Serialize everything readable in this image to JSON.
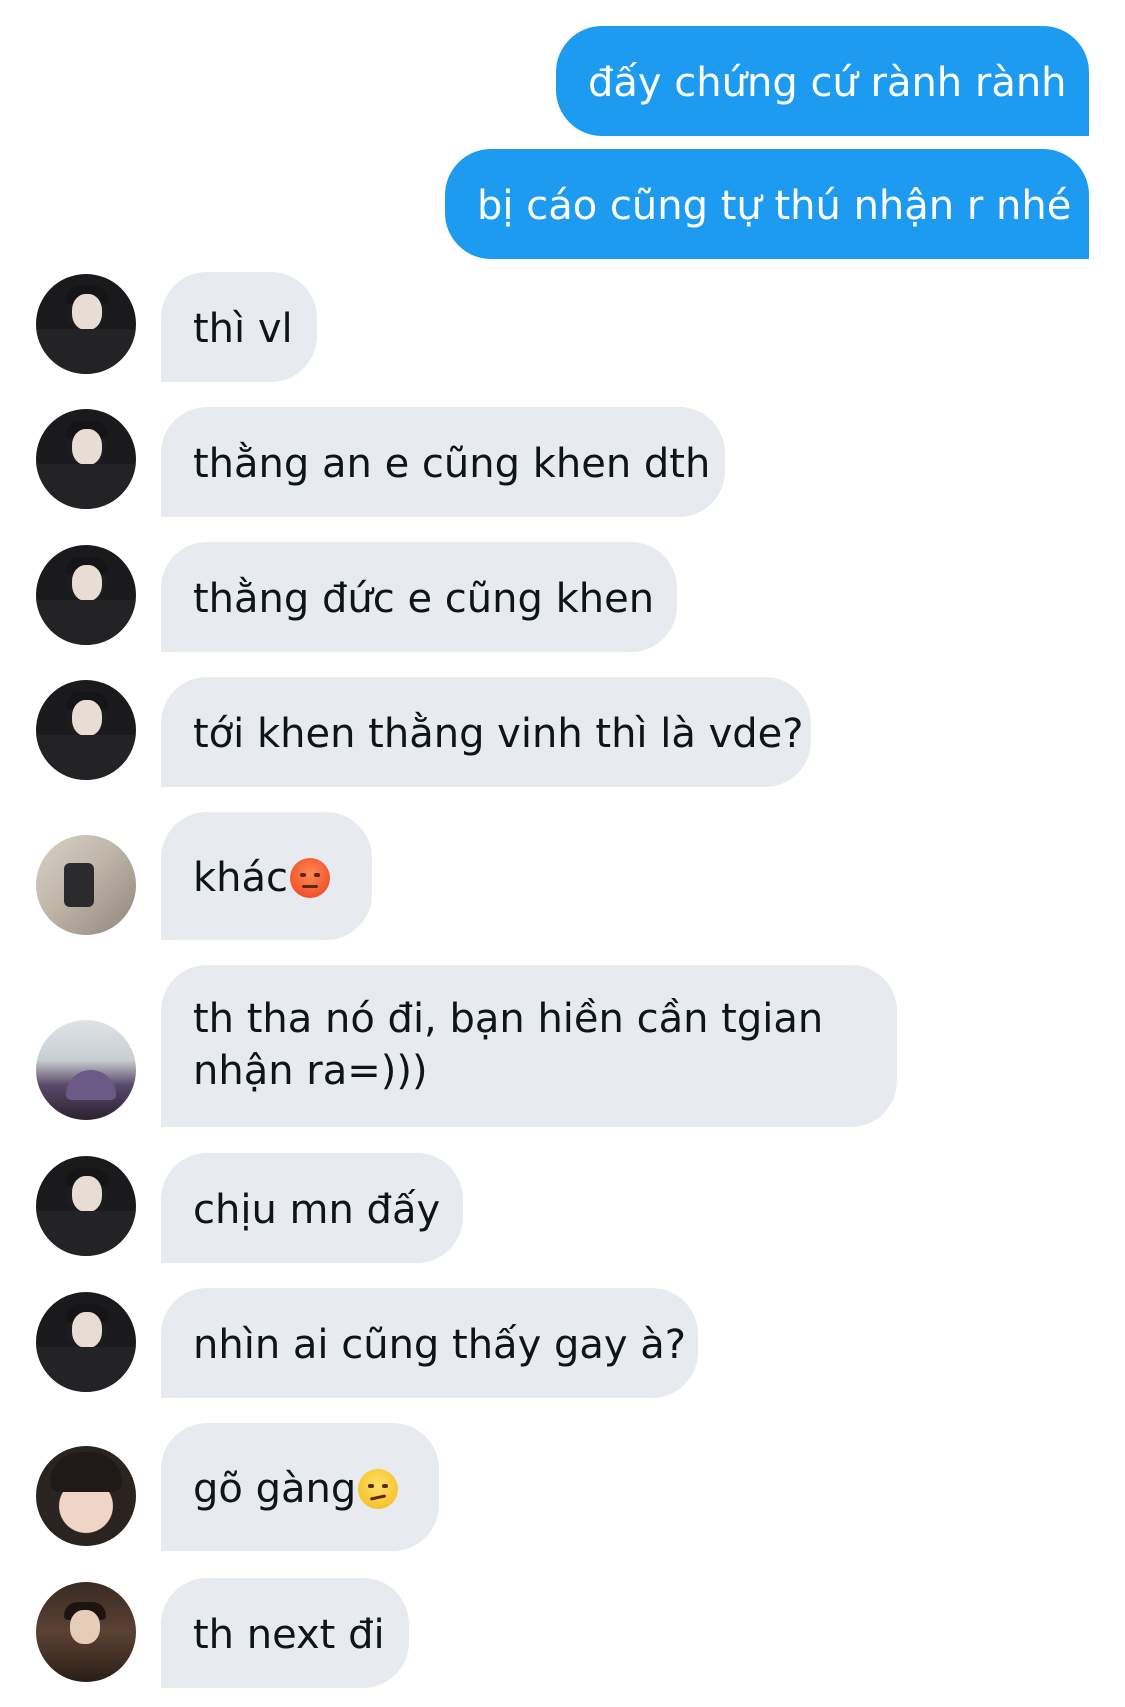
{
  "messages": [
    {
      "direction": "out",
      "text": "đấy chứng cứ rành rành"
    },
    {
      "direction": "out",
      "text": "bị cáo cũng tự thú nhận r nhé"
    },
    {
      "direction": "in",
      "avatar": "user-a-avatar",
      "text": "thì vl"
    },
    {
      "direction": "in",
      "avatar": "user-a-avatar",
      "text": "thằng an e cũng khen dth"
    },
    {
      "direction": "in",
      "avatar": "user-a-avatar",
      "text": "thằng đức e cũng khen"
    },
    {
      "direction": "in",
      "avatar": "user-a-avatar",
      "text": "tới khen thằng vinh thì là vde?"
    },
    {
      "direction": "in",
      "avatar": "user-b-avatar",
      "text": "khác",
      "emoji": "angry-face-emoji"
    },
    {
      "direction": "in",
      "avatar": "user-c-avatar",
      "text_line1": "th tha nó đi, bạn hiền cần tgian",
      "text_line2": "nhận ra=)))"
    },
    {
      "direction": "in",
      "avatar": "user-a-avatar",
      "text": "chịu mn đấy"
    },
    {
      "direction": "in",
      "avatar": "user-a-avatar",
      "text": "nhìn ai cũng thấy gay à?"
    },
    {
      "direction": "in",
      "avatar": "user-d-avatar",
      "text": "gõ gàng",
      "emoji": "smirking-face-emoji"
    },
    {
      "direction": "in",
      "avatar": "user-e-avatar",
      "text": "th next đi"
    }
  ],
  "colors": {
    "outgoing_bubble": "#1d9bf0",
    "incoming_bubble": "#e7ebef",
    "incoming_text": "#0f1419",
    "outgoing_text": "#ffffff",
    "background": "#ffffff"
  }
}
